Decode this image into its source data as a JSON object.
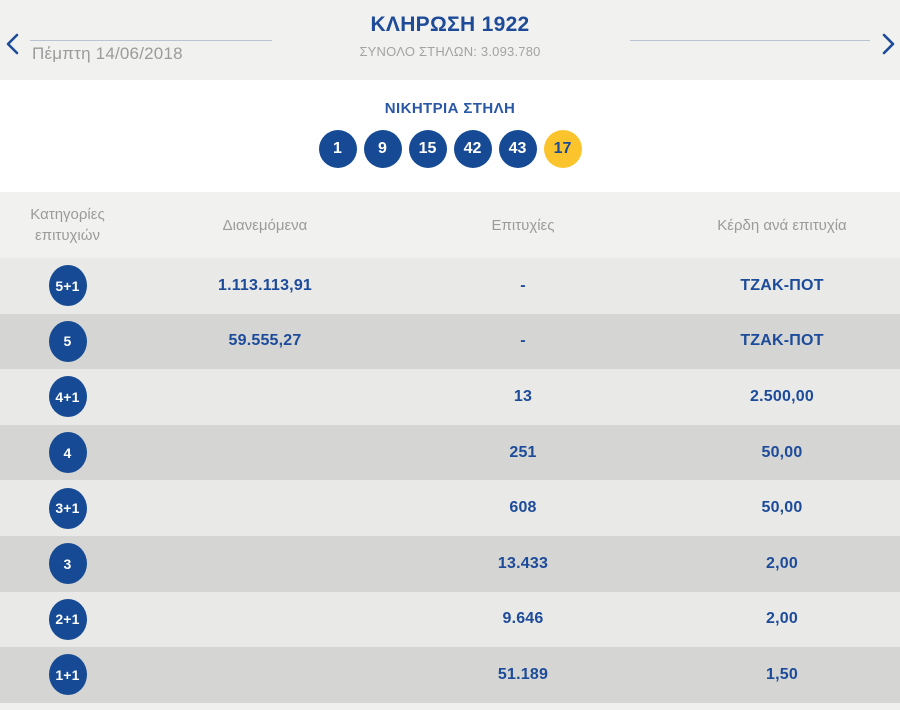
{
  "colors": {
    "accent_blue_text": "#1c4b9a",
    "title_blue": "#1d4b98",
    "ball_blue": "#164a94",
    "ball_bonus_yellow": "#fbc42d",
    "muted_gray_text": "#9b9b9b",
    "band_gray": "#f1f1ef",
    "row_light": "#e9e9e8",
    "row_dark": "#d5d5d4",
    "rule_line": "#b9c3d1"
  },
  "icons": {
    "prev": "chevron-left",
    "next": "chevron-right"
  },
  "header": {
    "draw_title": "ΚΛΗΡΩΣΗ 1922",
    "columns_total_label": "ΣΥΝΟΛΟ ΣΤΗΛΩΝ: 3.093.780",
    "date": "Πέμπτη 14/06/2018"
  },
  "winning": {
    "title": "ΝΙΚΗΤΡΙΑ ΣΤΗΛΗ",
    "numbers": [
      "1",
      "9",
      "15",
      "42",
      "43"
    ],
    "bonus": "17"
  },
  "table": {
    "headers": {
      "category_line1": "Κατηγορίες",
      "category_line2": "επιτυχιών",
      "distributed": "Διανεμόμενα",
      "winners": "Επιτυχίες",
      "prize": "Κέρδη ανά επιτυχία"
    },
    "rows": [
      {
        "category": "5+1",
        "distributed": "1.113.113,91",
        "winners": "-",
        "prize": "ΤΖΑΚ-ΠΟΤ"
      },
      {
        "category": "5",
        "distributed": "59.555,27",
        "winners": "-",
        "prize": "ΤΖΑΚ-ΠΟΤ"
      },
      {
        "category": "4+1",
        "distributed": "",
        "winners": "13",
        "prize": "2.500,00"
      },
      {
        "category": "4",
        "distributed": "",
        "winners": "251",
        "prize": "50,00"
      },
      {
        "category": "3+1",
        "distributed": "",
        "winners": "608",
        "prize": "50,00"
      },
      {
        "category": "3",
        "distributed": "",
        "winners": "13.433",
        "prize": "2,00"
      },
      {
        "category": "2+1",
        "distributed": "",
        "winners": "9.646",
        "prize": "2,00"
      },
      {
        "category": "1+1",
        "distributed": "",
        "winners": "51.189",
        "prize": "1,50"
      }
    ]
  }
}
